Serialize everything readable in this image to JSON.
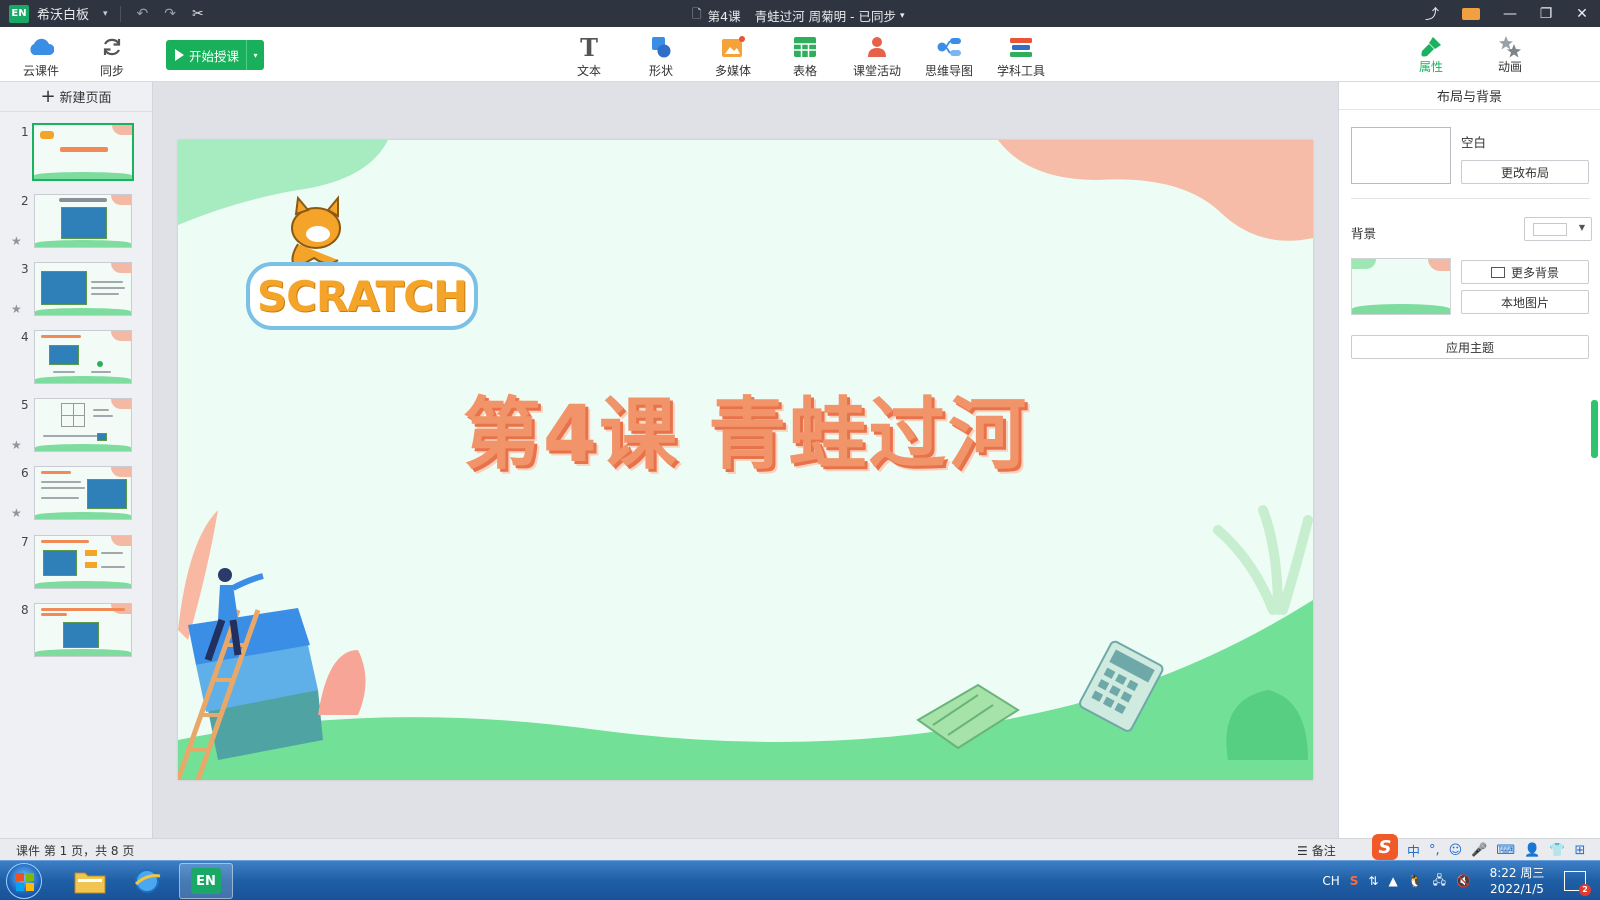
{
  "titlebar": {
    "logo": "EN",
    "app_name": "希沃白板",
    "doc_lesson": "第4课",
    "doc_title": "青蛙过河 周菊明 - 已同步",
    "caret": "▾"
  },
  "toolbar": {
    "left_tools": [
      {
        "label": "云课件",
        "icon": "cloud-icon"
      },
      {
        "label": "同步",
        "icon": "sync-icon"
      }
    ],
    "start_button": "开始授课",
    "center_tools": [
      {
        "label": "文本",
        "icon": "text-icon"
      },
      {
        "label": "形状",
        "icon": "shape-icon"
      },
      {
        "label": "多媒体",
        "icon": "media-icon"
      },
      {
        "label": "表格",
        "icon": "table-icon"
      },
      {
        "label": "课堂活动",
        "icon": "activity-icon"
      },
      {
        "label": "思维导图",
        "icon": "mindmap-icon"
      },
      {
        "label": "学科工具",
        "icon": "subject-tools-icon"
      }
    ],
    "right_tools": [
      {
        "label": "属性",
        "icon": "brush-icon"
      },
      {
        "label": "动画",
        "icon": "animation-icon"
      }
    ]
  },
  "left_panel": {
    "new_page": "新建页面",
    "pages": [
      "1",
      "2",
      "3",
      "4",
      "5",
      "6",
      "7",
      "8"
    ],
    "active_page": 1
  },
  "slide": {
    "logo_text": "SCRATCH",
    "title": "第4课  青蛙过河"
  },
  "right_panel": {
    "title": "布局与背景",
    "layout_name": "空白",
    "change_layout": "更改布局",
    "background_label": "背景",
    "more_backgrounds": "更多背景",
    "local_image": "本地图片",
    "apply_theme": "应用主题"
  },
  "statusbar": {
    "page_info": "课件 第 1 页，共 8 页",
    "notes": "备注",
    "ime_chars": [
      "中",
      "°,",
      "☺",
      "🎤",
      "⌨",
      "👤",
      "👕",
      "⊞"
    ]
  },
  "taskbar": {
    "lang": "CH",
    "time": "8:22 周三",
    "date": "2022/1/5",
    "notification_count": "2"
  },
  "colors": {
    "accent_green": "#18b05a",
    "slide_bg": "#eefcf6",
    "title_orange": "#f2946a"
  }
}
